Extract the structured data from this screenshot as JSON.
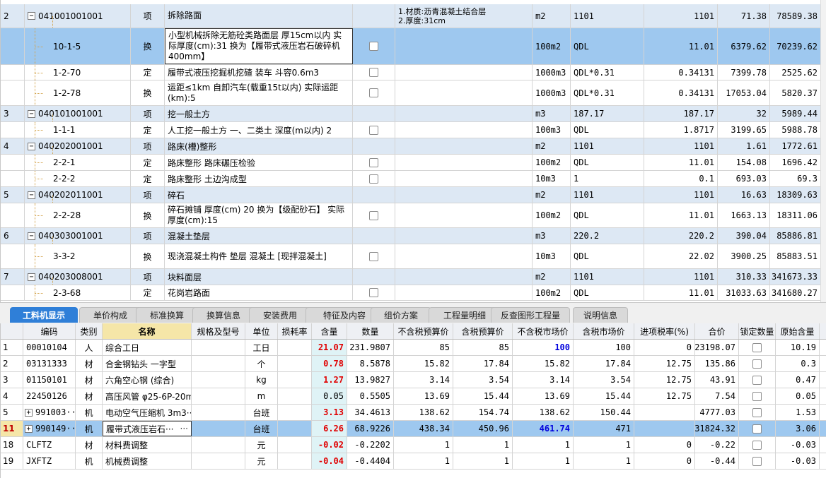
{
  "top_table": {
    "rows": [
      {
        "idx": "2",
        "code": "041001001001",
        "type": "项",
        "name": "拆除路面",
        "feature": "1.材质:沥青混凝土结合层\n2.厚度:31cm",
        "unit": "m2",
        "expr": "1101",
        "qty": "1101",
        "price": "71.38",
        "total": "78589.38",
        "kind": "item",
        "tree": "-"
      },
      {
        "idx": "",
        "code": "10-1-5",
        "type": "换",
        "name": "小型机械拆除无筋砼类路面层 厚15cm以内  实际厚度(cm):31   换为【履带式液压岩石破碎机 400mm】",
        "feature": "",
        "unit": "100m2",
        "expr": "QDL",
        "qty": "11.01",
        "price": "6379.62",
        "total": "70239.62",
        "kind": "sel",
        "tree": ""
      },
      {
        "idx": "",
        "code": "1-2-70",
        "type": "定",
        "name": "履带式液压挖掘机挖碴 装车 斗容0.6m3",
        "feature": "",
        "unit": "1000m3",
        "expr": "QDL*0.31",
        "qty": "0.34131",
        "price": "7399.78",
        "total": "2525.62",
        "kind": "sub",
        "tree": ""
      },
      {
        "idx": "",
        "code": "1-2-78",
        "type": "换",
        "name": "运距≤1km 自卸汽车(载重15t以内)  实际运距(km):5",
        "feature": "",
        "unit": "1000m3",
        "expr": "QDL*0.31",
        "qty": "0.34131",
        "price": "17053.04",
        "total": "5820.37",
        "kind": "sub",
        "tree": ""
      },
      {
        "idx": "3",
        "code": "040101001001",
        "type": "项",
        "name": "挖一般土方",
        "feature": "",
        "unit": "m3",
        "expr": "187.17",
        "qty": "187.17",
        "price": "32",
        "total": "5989.44",
        "kind": "item",
        "tree": "-"
      },
      {
        "idx": "",
        "code": "1-1-1",
        "type": "定",
        "name": "人工挖一般土方 一、二类土 深度(m以内) 2",
        "feature": "",
        "unit": "100m3",
        "expr": "QDL",
        "qty": "1.8717",
        "price": "3199.65",
        "total": "5988.78",
        "kind": "sub",
        "tree": ""
      },
      {
        "idx": "4",
        "code": "040202001001",
        "type": "项",
        "name": "路床(槽)整形",
        "feature": "",
        "unit": "m2",
        "expr": "1101",
        "qty": "1101",
        "price": "1.61",
        "total": "1772.61",
        "kind": "item",
        "tree": "-"
      },
      {
        "idx": "",
        "code": "2-2-1",
        "type": "定",
        "name": "路床整形 路床碾压检验",
        "feature": "",
        "unit": "100m2",
        "expr": "QDL",
        "qty": "11.01",
        "price": "154.08",
        "total": "1696.42",
        "kind": "sub",
        "tree": ""
      },
      {
        "idx": "",
        "code": "2-2-2",
        "type": "定",
        "name": "路床整形 土边沟成型",
        "feature": "",
        "unit": "10m3",
        "expr": "1",
        "qty": "0.1",
        "price": "693.03",
        "total": "69.3",
        "kind": "sub",
        "tree": ""
      },
      {
        "idx": "5",
        "code": "040202011001",
        "type": "项",
        "name": "碎石",
        "feature": "",
        "unit": "m2",
        "expr": "1101",
        "qty": "1101",
        "price": "16.63",
        "total": "18309.63",
        "kind": "item",
        "tree": "-"
      },
      {
        "idx": "",
        "code": "2-2-28",
        "type": "换",
        "name": "碎石摊铺 厚度(cm) 20   换为【级配砂石】   实际厚度(cm):15",
        "feature": "",
        "unit": "100m2",
        "expr": "QDL",
        "qty": "11.01",
        "price": "1663.13",
        "total": "18311.06",
        "kind": "sub",
        "tree": ""
      },
      {
        "idx": "6",
        "code": "040303001001",
        "type": "项",
        "name": "混凝土垫层",
        "feature": "",
        "unit": "m3",
        "expr": "220.2",
        "qty": "220.2",
        "price": "390.04",
        "total": "85886.81",
        "kind": "item",
        "tree": "-"
      },
      {
        "idx": "",
        "code": "3-3-2",
        "type": "换",
        "name": "现浇混凝土构件 垫层 混凝土  [现拌混凝土]",
        "feature": "",
        "unit": "10m3",
        "expr": "QDL",
        "qty": "22.02",
        "price": "3900.25",
        "total": "85883.51",
        "kind": "sub",
        "tree": ""
      },
      {
        "idx": "7",
        "code": "040203008001",
        "type": "项",
        "name": "块料面层",
        "feature": "",
        "unit": "m2",
        "expr": "1101",
        "qty": "1101",
        "price": "310.33",
        "total": "341673.33",
        "kind": "item",
        "tree": "-"
      },
      {
        "idx": "",
        "code": "2-3-68",
        "type": "定",
        "name": "花岗岩路面",
        "feature": "",
        "unit": "100m2",
        "expr": "QDL",
        "qty": "11.01",
        "price": "31033.63",
        "total": "341680.27",
        "kind": "sub",
        "tree": ""
      }
    ]
  },
  "tabs": [
    {
      "label": "工料机显示",
      "active": true
    },
    {
      "label": "单价构成",
      "active": false
    },
    {
      "label": "标准换算",
      "active": false
    },
    {
      "label": "换算信息",
      "active": false
    },
    {
      "label": "安装费用",
      "active": false
    },
    {
      "label": "特征及内容",
      "active": false
    },
    {
      "label": "组价方案",
      "active": false
    },
    {
      "label": "工程量明细",
      "active": false
    },
    {
      "label": "反查图形工程量",
      "active": false
    },
    {
      "label": "说明信息",
      "active": false
    }
  ],
  "bottom_table": {
    "headers": [
      "编码",
      "类别",
      "名称",
      "规格及型号",
      "单位",
      "损耗率",
      "含量",
      "数量",
      "不含税预算价",
      "含税预算价",
      "不含税市场价",
      "含税市场价",
      "进项税率(%)",
      "合价",
      "锁定数量",
      "原始含量"
    ],
    "rows": [
      {
        "idx": "1",
        "code": "00010104",
        "type": "人",
        "name": "综合工日",
        "spec": "",
        "unit": "工日",
        "loss": "",
        "content": "21.07",
        "qty": "231.9807",
        "p1": "85",
        "p2": "85",
        "p3": "100",
        "p4": "100",
        "tax": "0",
        "sum": "23198.07",
        "orig": "10.19",
        "content_red": true,
        "p3_blue": true,
        "expand": false,
        "sel": false
      },
      {
        "idx": "2",
        "code": "03131333",
        "type": "材",
        "name": "合金钢钻头 一字型",
        "spec": "",
        "unit": "个",
        "loss": "",
        "content": "0.78",
        "qty": "8.5878",
        "p1": "15.82",
        "p2": "17.84",
        "p3": "15.82",
        "p4": "17.84",
        "tax": "12.75",
        "sum": "135.86",
        "orig": "0.3",
        "content_red": true,
        "p3_blue": false,
        "expand": false,
        "sel": false
      },
      {
        "idx": "3",
        "code": "01150101",
        "type": "材",
        "name": "六角空心钢 (综合)",
        "spec": "",
        "unit": "kg",
        "loss": "",
        "content": "1.27",
        "qty": "13.9827",
        "p1": "3.14",
        "p2": "3.54",
        "p3": "3.14",
        "p4": "3.54",
        "tax": "12.75",
        "sum": "43.91",
        "orig": "0.47",
        "content_red": true,
        "p3_blue": false,
        "expand": false,
        "sel": false
      },
      {
        "idx": "4",
        "code": "22450126",
        "type": "材",
        "name": "高压风管 φ25-6P-20m",
        "spec": "",
        "unit": "m",
        "loss": "",
        "content": "0.05",
        "qty": "0.5505",
        "p1": "13.69",
        "p2": "15.44",
        "p3": "13.69",
        "p4": "15.44",
        "tax": "12.75",
        "sum": "7.54",
        "orig": "0.05",
        "content_red": false,
        "p3_blue": false,
        "expand": false,
        "sel": false
      },
      {
        "idx": "5",
        "code": "991003···",
        "type": "机",
        "name": "电动空气压缩机 3m3···",
        "spec": "",
        "unit": "台班",
        "loss": "",
        "content": "3.13",
        "qty": "34.4613",
        "p1": "138.62",
        "p2": "154.74",
        "p3": "138.62",
        "p4": "150.44",
        "tax": "",
        "sum": "4777.03",
        "orig": "1.53",
        "content_red": true,
        "p3_blue": false,
        "expand": true,
        "sel": false
      },
      {
        "idx": "11",
        "code": "990149···",
        "type": "机",
        "name": "履带式液压岩石···",
        "spec": "",
        "unit": "台班",
        "loss": "",
        "content": "6.26",
        "qty": "68.9226",
        "p1": "438.34",
        "p2": "450.96",
        "p3": "461.74",
        "p4": "471",
        "tax": "",
        "sum": "31824.32",
        "orig": "3.06",
        "content_red": true,
        "p3_blue": true,
        "expand": true,
        "sel": true
      },
      {
        "idx": "18",
        "code": "CLFTZ",
        "type": "材",
        "name": "材料费调整",
        "spec": "",
        "unit": "元",
        "loss": "",
        "content": "-0.02",
        "qty": "-0.2202",
        "p1": "1",
        "p2": "1",
        "p3": "1",
        "p4": "1",
        "tax": "0",
        "sum": "-0.22",
        "orig": "-0.03",
        "content_red": true,
        "p3_blue": false,
        "expand": false,
        "sel": false
      },
      {
        "idx": "19",
        "code": "JXFTZ",
        "type": "机",
        "name": "机械费调整",
        "spec": "",
        "unit": "元",
        "loss": "",
        "content": "-0.04",
        "qty": "-0.4404",
        "p1": "1",
        "p2": "1",
        "p3": "1",
        "p4": "1",
        "tax": "0",
        "sum": "-0.44",
        "orig": "-0.03",
        "content_red": true,
        "p3_blue": false,
        "expand": false,
        "sel": false
      }
    ]
  },
  "icons": {
    "expand": "plus-box-icon",
    "collapse": "minus-box-icon",
    "ellipsis": "ellipsis-icon"
  },
  "colors": {
    "selected_row": "#9ec8ef",
    "item_row": "#dde8f4",
    "active_tab": "#2f7fd8",
    "content_red": "#e00000",
    "price_blue": "#0000dd",
    "name_header": "#f5e6a8"
  }
}
